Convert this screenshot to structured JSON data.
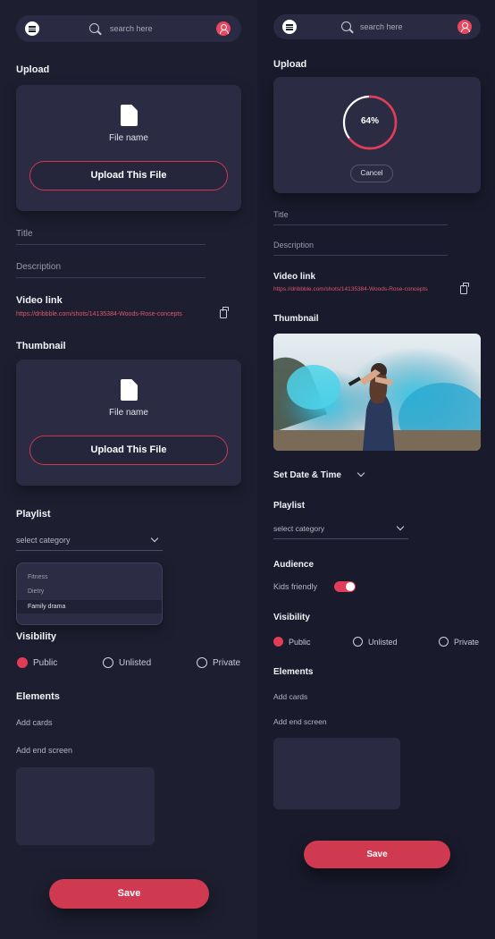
{
  "search": {
    "placeholder": "search here"
  },
  "left": {
    "upload": {
      "heading": "Upload",
      "file_name": "File name",
      "button": "Upload This File"
    },
    "title_field": "Title",
    "description_field": "Description",
    "video_link": {
      "heading": "Video link",
      "url": "https://dribbble.com/shots/14135384-Woods-Rose-concepts"
    },
    "thumbnail": {
      "heading": "Thumbnail",
      "file_name": "File name",
      "button": "Upload This File"
    },
    "playlist": {
      "heading": "Playlist",
      "select_value": "select category",
      "options": [
        "Fitness",
        "Dietry",
        "Family drama"
      ],
      "selected_option": "Family drama"
    },
    "visibility": {
      "heading": "Visibility",
      "options": [
        "Public",
        "Unlisted",
        "Private"
      ],
      "selected": "Public"
    },
    "elements": {
      "heading": "Elements",
      "add_cards": "Add cards",
      "add_end_screen": "Add end screen"
    },
    "save": "Save"
  },
  "right": {
    "upload": {
      "heading": "Upload",
      "progress_label": "64%",
      "progress": 0.64,
      "cancel": "Cancel"
    },
    "title_field": "Title",
    "description_field": "Description",
    "video_link": {
      "heading": "Video link",
      "url": "https://dribbble.com/shots/14135384-Woods-Rose-concepts"
    },
    "thumbnail": {
      "heading": "Thumbnail"
    },
    "date_time": "Set Date & Time",
    "playlist": {
      "heading": "Playlist",
      "select_value": "select category"
    },
    "audience": {
      "heading": "Audience",
      "kids_friendly": "Kids friendly",
      "kids_friendly_on": true
    },
    "visibility": {
      "heading": "Visibility",
      "options": [
        "Public",
        "Unlisted",
        "Private"
      ],
      "selected": "Public"
    },
    "elements": {
      "heading": "Elements",
      "add_cards": "Add cards",
      "add_end_screen": "Add end screen"
    },
    "save": "Save"
  },
  "colors": {
    "accent": "#e23c56",
    "background": "#1d1f31",
    "card": "#2b2c44"
  },
  "icons": [
    "menu-icon",
    "search-icon",
    "user-icon",
    "file-icon",
    "copy-icon",
    "chevron-down-icon"
  ]
}
